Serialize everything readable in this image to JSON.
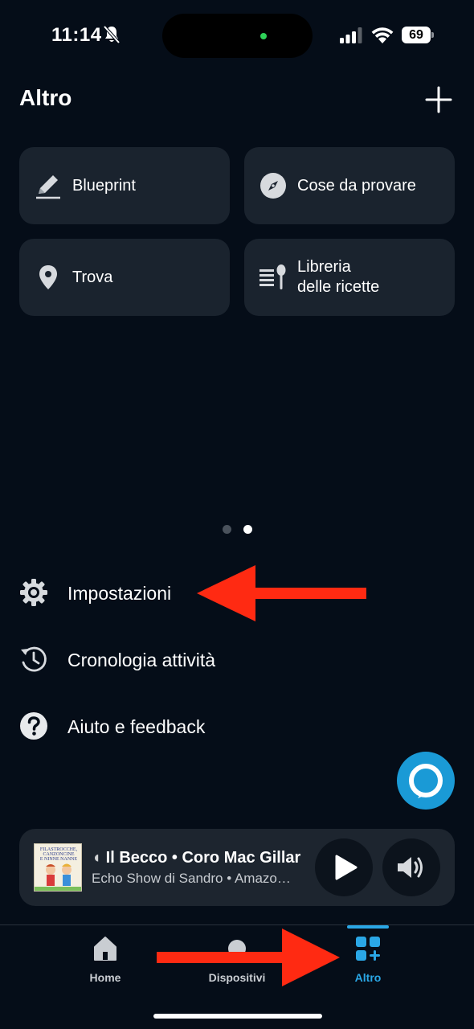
{
  "status_bar": {
    "time": "11:14",
    "battery": "69"
  },
  "header": {
    "title": "Altro"
  },
  "tiles": [
    {
      "label": "Blueprint",
      "icon": "pencil-icon"
    },
    {
      "label": "Cose da provare",
      "icon": "compass-icon"
    },
    {
      "label": "Trova",
      "icon": "location-pin-icon"
    },
    {
      "label": "Libreria\ndelle ricette",
      "label_line1": "Libreria",
      "label_line2": "delle ricette",
      "icon": "recipe-library-icon"
    }
  ],
  "pagination": {
    "pages": 2,
    "current": 2
  },
  "menu": [
    {
      "label": "Impostazioni",
      "icon": "gear-icon"
    },
    {
      "label": "Cronologia attività",
      "icon": "history-icon"
    },
    {
      "label": "Aiuto e feedback",
      "icon": "help-icon"
    }
  ],
  "player": {
    "title": "Il Becco • Coro Mac Gillar",
    "title_prefix": "◖",
    "subtitle": "Echo Show di Sandro • Amazo…",
    "album_art_text": "FILASTROCCHE, CANZONCINE E NINNE NANNE"
  },
  "tab_bar": {
    "tabs": [
      {
        "label": "Home",
        "icon": "home-icon"
      },
      {
        "label": "Dispositivi",
        "icon": "devices-icon"
      },
      {
        "label": "Altro",
        "icon": "more-grid-icon",
        "active": true
      }
    ]
  },
  "colors": {
    "background": "#050d18",
    "tile": "#1a232e",
    "accent": "#2aa7e6",
    "alexa_blue": "#1a9ad6",
    "annotation_arrow": "#ff2a12"
  }
}
